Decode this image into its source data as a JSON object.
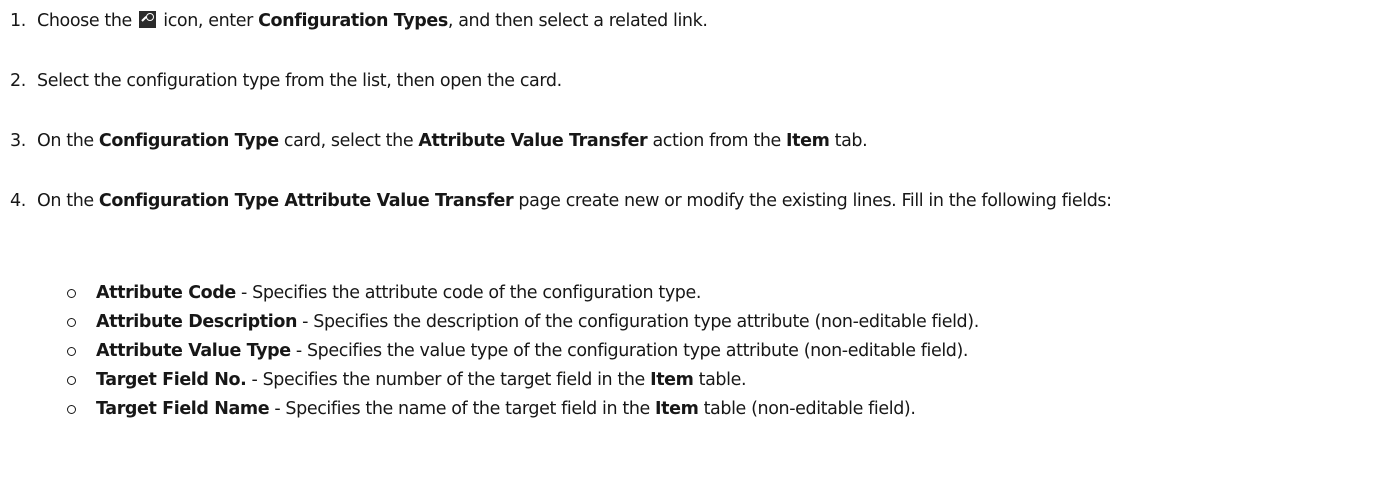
{
  "steps": [
    {
      "number": "1.",
      "t1": "Choose the",
      "t2": "icon, enter",
      "b1": "Configuration Types",
      "t3": ", and then select a related link."
    },
    {
      "number": "2.",
      "t1": "Select the configuration type from the list, then open the card."
    },
    {
      "number": "3.",
      "t1": "On the",
      "b1": "Configuration Type",
      "t2": "card, select the",
      "b2": "Attribute Value Transfer",
      "t3": "action from the",
      "b3": "Item",
      "t4": "tab."
    },
    {
      "number": "4.",
      "t1": "On the",
      "b1": "Configuration Type Attribute Value Transfer",
      "t2": "page create new or modify the existing lines. Fill in the following fields:"
    }
  ],
  "fields": [
    {
      "name": "Attribute Code",
      "desc": " - Specifies the attribute code of the configuration type."
    },
    {
      "name": "Attribute Description",
      "desc": " - Specifies the description of the configuration type attribute (non-editable field)."
    },
    {
      "name": "Attribute Value Type",
      "desc": " - Specifies the value type of the configuration type attribute (non-editable field)."
    },
    {
      "name": "Target Field No.",
      "desc": " - Specifies the number of the target field in the ",
      "bold2": "Item",
      "tail": " table."
    },
    {
      "name": "Target Field Name",
      "desc": " - Specifies the name of the target field in the ",
      "bold2": "Item",
      "tail": " table (non-editable field)."
    }
  ]
}
